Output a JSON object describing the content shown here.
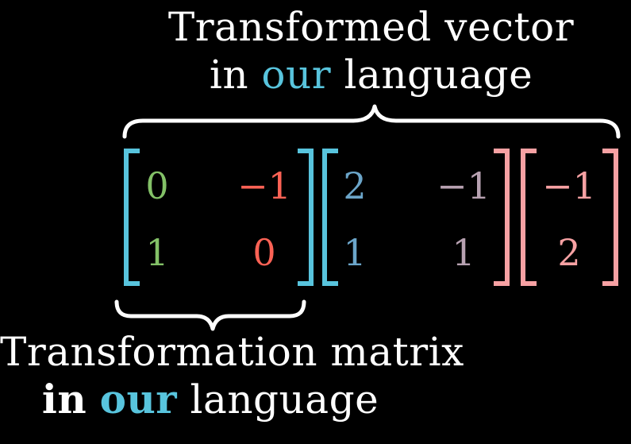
{
  "top_label": {
    "line1": "Transformed vector",
    "line2_prefix": "in ",
    "line2_accent": "our",
    "line2_suffix": " language"
  },
  "bottom_label": {
    "line1": "Transformation matrix",
    "line2_prefix": "in",
    "line2_accent": "our",
    "line2_suffix": "language"
  },
  "matrix_a": {
    "bracket_color": "#58c4dd",
    "entries": [
      {
        "text": "0",
        "color": "#83c167"
      },
      {
        "text": "−1",
        "color": "#fc6255"
      },
      {
        "text": "1",
        "color": "#83c167"
      },
      {
        "text": "0",
        "color": "#fc6255"
      }
    ]
  },
  "matrix_b": {
    "bracket_color": "#58c4dd",
    "entries": [
      {
        "text": "2",
        "color": "#6ba5c9"
      },
      {
        "text": "−1",
        "color": "#b7a1b1"
      },
      {
        "text": "1",
        "color": "#6ba5c9"
      },
      {
        "text": "1",
        "color": "#b7a1b1"
      }
    ]
  },
  "vector_c": {
    "bracket_color": "#f7a1a3",
    "entries": [
      {
        "text": "−1",
        "color": "#f7a1a3"
      },
      {
        "text": "2",
        "color": "#f7a1a3"
      }
    ]
  },
  "colors": {
    "background": "#000000",
    "text": "#ffffff",
    "accent_blue": "#58c4dd",
    "green": "#83c167",
    "red": "#fc6255",
    "pink": "#f7a1a3"
  }
}
